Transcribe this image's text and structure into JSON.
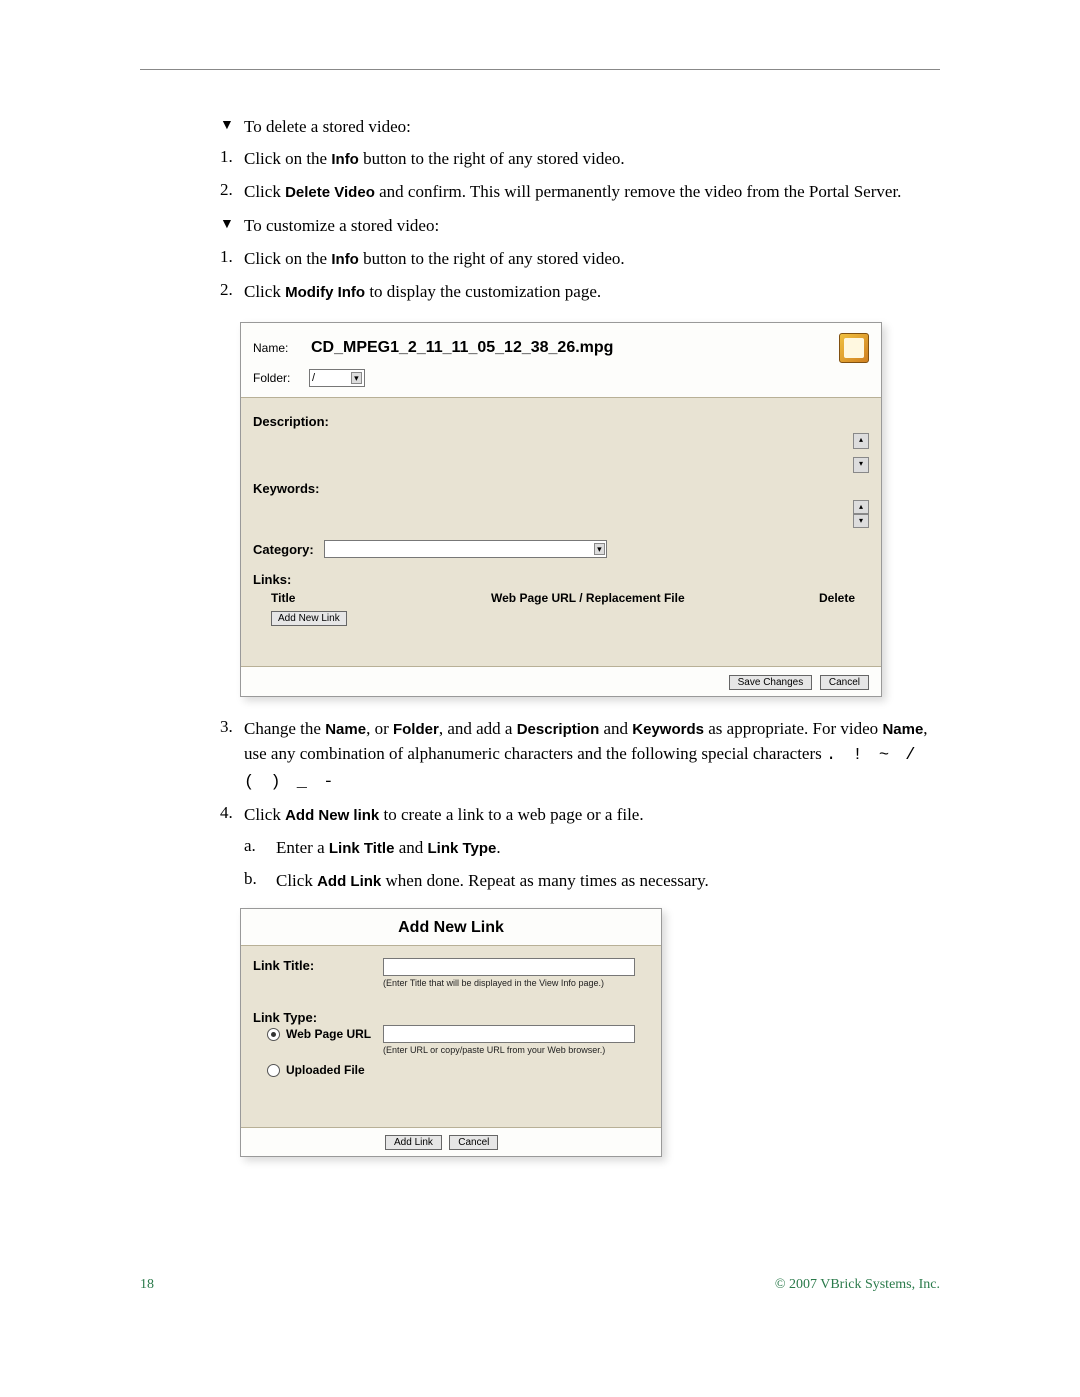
{
  "instructions": {
    "delete_heading": "To delete a stored video:",
    "delete_step1_pre": "Click on the ",
    "delete_step1_bold": "Info",
    "delete_step1_post": " button to the right of any stored video.",
    "delete_step2_pre": "Click ",
    "delete_step2_bold": "Delete Video",
    "delete_step2_post": " and confirm. This will permanently remove the video from the Portal Server.",
    "custom_heading": "To customize a stored video:",
    "custom_step1_pre": "Click on the ",
    "custom_step1_bold": "Info",
    "custom_step1_post": " button to the right of any stored video.",
    "custom_step2_pre": "Click ",
    "custom_step2_bold": "Modify Info",
    "custom_step2_post": " to display the customization page.",
    "step3_pre": "Change the ",
    "step3_b1": "Name",
    "step3_m1": ", or ",
    "step3_b2": "Folder",
    "step3_m2": ", and add a ",
    "step3_b3": "Description",
    "step3_m3": " and ",
    "step3_b4": "Keywords",
    "step3_m4": " as appropriate. For video ",
    "step3_b5": "Name",
    "step3_m5": ", use any combination of alphanumeric characters and the following special characters ",
    "step3_chars": ". ! ~ / ( ) _ -",
    "step4_pre": "Click ",
    "step4_bold": "Add New link",
    "step4_post": " to create a link to a web page or a file.",
    "step4a_pre": "Enter a ",
    "step4a_b1": "Link Title",
    "step4a_mid": " and ",
    "step4a_b2": "Link Type",
    "step4a_post": ".",
    "step4b_pre": "Click ",
    "step4b_bold": "Add Link",
    "step4b_post": " when done. Repeat as many times as necessary."
  },
  "list_markers": {
    "n1": "1.",
    "n2": "2.",
    "n3": "3.",
    "n4": "4.",
    "a": "a.",
    "b": "b."
  },
  "shot1": {
    "name_label": "Name:",
    "name_value": "CD_MPEG1_2_11_11_05_12_38_26.mpg",
    "folder_label": "Folder:",
    "folder_value": "/",
    "description_label": "Description:",
    "keywords_label": "Keywords:",
    "category_label": "Category:",
    "links_label": "Links:",
    "col_title": "Title",
    "col_url": "Web Page URL / Replacement File",
    "col_delete": "Delete",
    "add_new_link_btn": "Add New Link",
    "save_btn": "Save Changes",
    "cancel_btn": "Cancel"
  },
  "shot2": {
    "title": "Add New Link",
    "link_title_label": "Link Title:",
    "link_title_hint": "(Enter Title that will be displayed in the View Info page.)",
    "link_type_label": "Link Type:",
    "radio_url": "Web Page URL",
    "url_hint": "(Enter URL or copy/paste URL from your Web browser.)",
    "radio_file": "Uploaded File",
    "add_link_btn": "Add Link",
    "cancel_btn": "Cancel"
  },
  "footer": {
    "page": "18",
    "copyright": "© 2007 VBrick Systems, Inc."
  }
}
